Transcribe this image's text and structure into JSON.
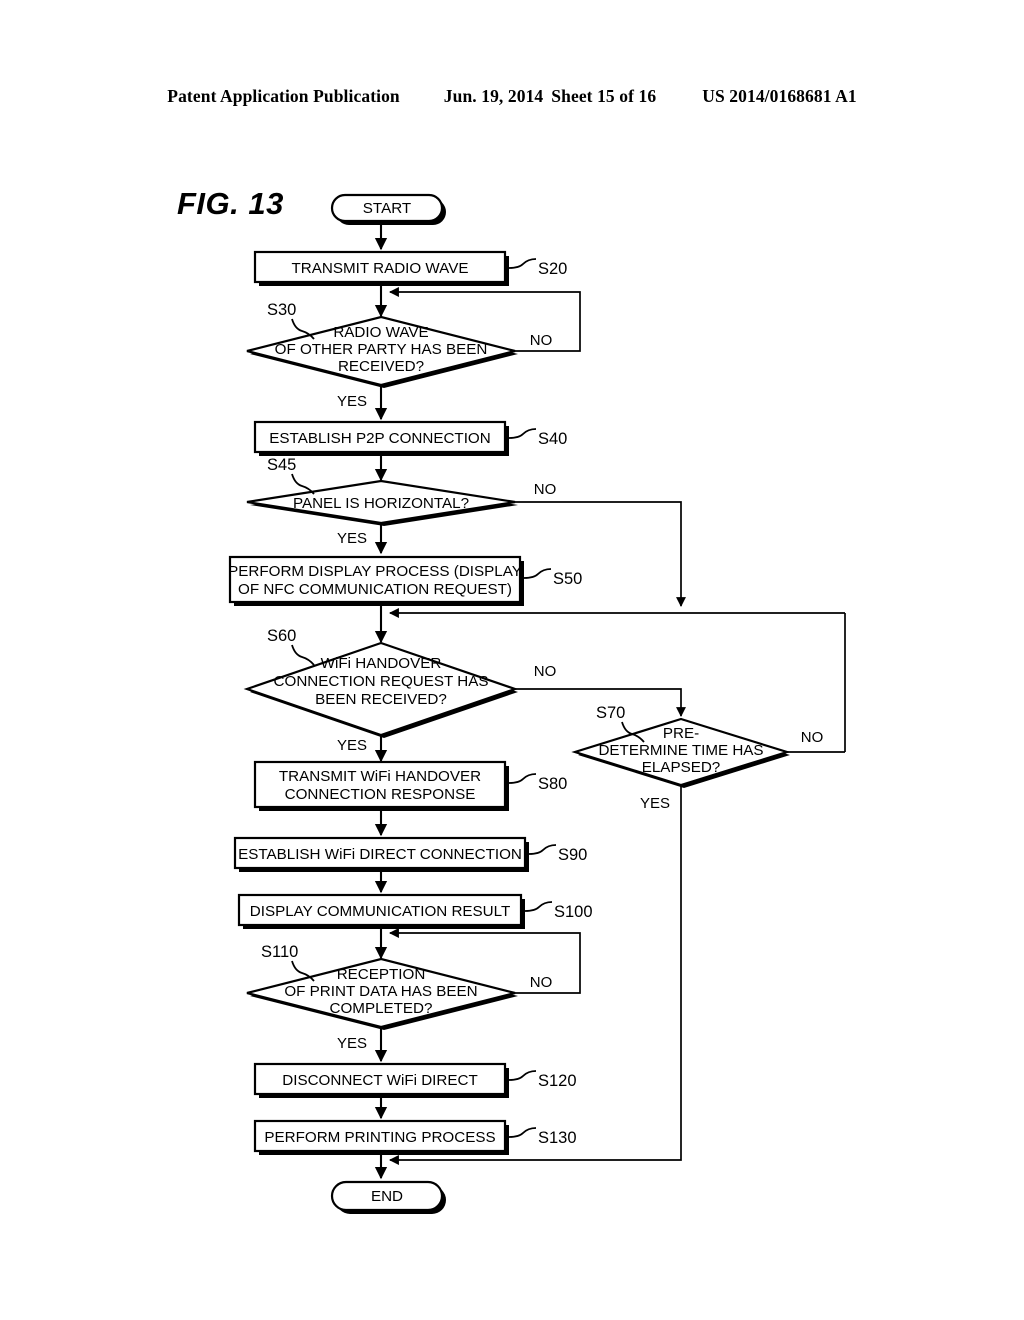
{
  "header": {
    "publication": "Patent Application Publication",
    "date": "Jun. 19, 2014",
    "sheet": "Sheet 15 of 16",
    "patent_number": "US 2014/0168681 A1"
  },
  "figure": {
    "label": "FIG. 13",
    "type": "flowchart"
  },
  "chart_data": {
    "type": "flowchart",
    "title": "FIG. 13",
    "nodes": [
      {
        "id": "START",
        "shape": "terminator",
        "text": "START",
        "step": ""
      },
      {
        "id": "S20",
        "shape": "process",
        "text": "TRANSMIT RADIO WAVE",
        "step": "S20"
      },
      {
        "id": "S30",
        "shape": "decision",
        "text": "RADIO WAVE OF OTHER PARTY HAS BEEN RECEIVED?",
        "step": "S30"
      },
      {
        "id": "S40",
        "shape": "process",
        "text": "ESTABLISH P2P CONNECTION",
        "step": "S40"
      },
      {
        "id": "S45",
        "shape": "decision",
        "text": "PANEL IS HORIZONTAL?",
        "step": "S45"
      },
      {
        "id": "S50",
        "shape": "process",
        "text": "PERFORM DISPLAY PROCESS (DISPLAY OF NFC COMMUNICATION REQUEST)",
        "step": "S50"
      },
      {
        "id": "S60",
        "shape": "decision",
        "text": "WiFi HANDOVER CONNECTION REQUEST HAS BEEN RECEIVED?",
        "step": "S60"
      },
      {
        "id": "S70",
        "shape": "decision",
        "text": "PRE-DETERMINE TIME HAS ELAPSED?",
        "step": "S70"
      },
      {
        "id": "S80",
        "shape": "process",
        "text": "TRANSMIT WiFi HANDOVER CONNECTION RESPONSE",
        "step": "S80"
      },
      {
        "id": "S90",
        "shape": "process",
        "text": "ESTABLISH WiFi DIRECT CONNECTION",
        "step": "S90"
      },
      {
        "id": "S100",
        "shape": "process",
        "text": "DISPLAY COMMUNICATION RESULT",
        "step": "S100"
      },
      {
        "id": "S110",
        "shape": "decision",
        "text": "RECEPTION OF PRINT DATA HAS BEEN COMPLETED?",
        "step": "S110"
      },
      {
        "id": "S120",
        "shape": "process",
        "text": "DISCONNECT WiFi DIRECT",
        "step": "S120"
      },
      {
        "id": "S130",
        "shape": "process",
        "text": "PERFORM PRINTING PROCESS",
        "step": "S130"
      },
      {
        "id": "END",
        "shape": "terminator",
        "text": "END",
        "step": ""
      }
    ],
    "edges": [
      {
        "from": "START",
        "to": "S20",
        "label": ""
      },
      {
        "from": "S20",
        "to": "S30",
        "label": ""
      },
      {
        "from": "S30",
        "to": "S40",
        "label": "YES"
      },
      {
        "from": "S30",
        "to": "S20",
        "label": "NO"
      },
      {
        "from": "S40",
        "to": "S45",
        "label": ""
      },
      {
        "from": "S45",
        "to": "S50",
        "label": "YES"
      },
      {
        "from": "S45",
        "to": "S60",
        "label": "NO"
      },
      {
        "from": "S50",
        "to": "S60",
        "label": ""
      },
      {
        "from": "S60",
        "to": "S80",
        "label": "YES"
      },
      {
        "from": "S60",
        "to": "S70",
        "label": "NO"
      },
      {
        "from": "S70",
        "to": "END",
        "label": "YES"
      },
      {
        "from": "S70",
        "to": "S60",
        "label": "NO"
      },
      {
        "from": "S80",
        "to": "S90",
        "label": ""
      },
      {
        "from": "S90",
        "to": "S100",
        "label": ""
      },
      {
        "from": "S100",
        "to": "S110",
        "label": ""
      },
      {
        "from": "S110",
        "to": "S120",
        "label": "YES"
      },
      {
        "from": "S110",
        "to": "S100",
        "label": "NO"
      },
      {
        "from": "S120",
        "to": "S130",
        "label": ""
      },
      {
        "from": "S130",
        "to": "END",
        "label": ""
      }
    ]
  },
  "nodes": {
    "start": {
      "text": "START"
    },
    "s20": {
      "text": "TRANSMIT RADIO WAVE",
      "step": "S20"
    },
    "s30": {
      "line1": "RADIO WAVE",
      "line2": "OF OTHER PARTY HAS BEEN",
      "line3": "RECEIVED?",
      "step": "S30",
      "yes": "YES",
      "no": "NO"
    },
    "s40": {
      "text": "ESTABLISH P2P CONNECTION",
      "step": "S40"
    },
    "s45": {
      "text": "PANEL IS HORIZONTAL?",
      "step": "S45",
      "yes": "YES",
      "no": "NO"
    },
    "s50": {
      "line1": "PERFORM DISPLAY PROCESS (DISPLAY",
      "line2": "OF NFC COMMUNICATION REQUEST)",
      "step": "S50"
    },
    "s60": {
      "line1": "WiFi HANDOVER",
      "line2": "CONNECTION REQUEST HAS",
      "line3": "BEEN RECEIVED?",
      "step": "S60",
      "yes": "YES",
      "no": "NO"
    },
    "s70": {
      "line1": "PRE-",
      "line2": "DETERMINE TIME HAS",
      "line3": "ELAPSED?",
      "step": "S70",
      "yes": "YES",
      "no": "NO"
    },
    "s80": {
      "line1": "TRANSMIT WiFi HANDOVER",
      "line2": "CONNECTION RESPONSE",
      "step": "S80"
    },
    "s90": {
      "text": "ESTABLISH WiFi DIRECT CONNECTION",
      "step": "S90"
    },
    "s100": {
      "text": "DISPLAY COMMUNICATION RESULT",
      "step": "S100"
    },
    "s110": {
      "line1": "RECEPTION",
      "line2": "OF PRINT DATA HAS BEEN",
      "line3": "COMPLETED?",
      "step": "S110",
      "yes": "YES",
      "no": "NO"
    },
    "s120": {
      "text": "DISCONNECT WiFi DIRECT",
      "step": "S120"
    },
    "s130": {
      "text": "PERFORM PRINTING PROCESS",
      "step": "S130"
    },
    "end": {
      "text": "END"
    }
  }
}
